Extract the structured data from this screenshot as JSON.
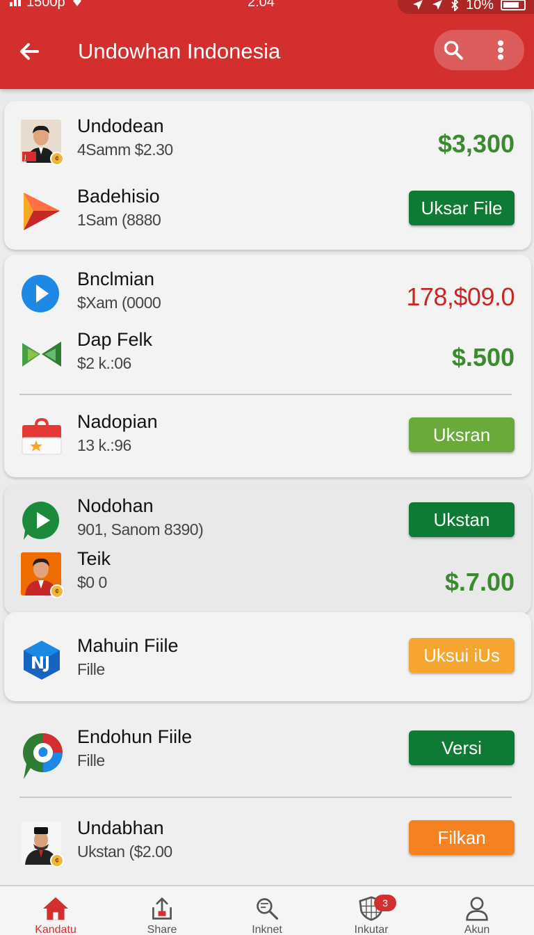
{
  "status_bar": {
    "left": "1500p",
    "time": "2:04",
    "battery": "10%"
  },
  "header": {
    "title": "Undowhan Indonesia"
  },
  "colors": {
    "header_red": "#d32f2f",
    "amount_green": "#3a8a2e",
    "amount_red": "#c62828",
    "button_dark_green": "#0f7a36",
    "button_light_green": "#6aaa3a",
    "button_amber": "#f6a531",
    "button_orange": "#f58220"
  },
  "items": [
    {
      "name": "Undodean",
      "sub": "4Samm $2.30",
      "amount": "$3,300",
      "icon": "avatar-icon"
    },
    {
      "name": "Badehisio",
      "sub": "1Sam (8880",
      "button": "Uksar File",
      "icon": "play-store-triangle-icon"
    },
    {
      "name": "Bnclmian",
      "sub": "$Xam (0000",
      "amount": "178,$09.0",
      "icon": "play-circle-icon"
    },
    {
      "name": "Dap Felk",
      "sub": "$2 k.:06",
      "amount": "$.500",
      "icon": "green-bowtie-icon"
    },
    {
      "name": "Nadopian",
      "sub": "13 k.:96",
      "button": "Uksran",
      "icon": "briefcase-icon"
    },
    {
      "name": "Nodohan",
      "sub": "901, Sanom 8390)",
      "button": "Ukstan",
      "icon": "play-chat-icon"
    },
    {
      "name": "Teik",
      "sub": "$0 0",
      "amount": "$.7.00",
      "icon": "avatar-icon"
    },
    {
      "name": "Mahuin Fiile",
      "sub": "Fille",
      "button": "Uksui iUs",
      "icon": "blue-hex-icon"
    },
    {
      "name": "Endohun Fiile",
      "sub": "Fille",
      "button": "Versi",
      "icon": "colorful-chat-icon"
    },
    {
      "name": "Undabhan",
      "sub": "Ukstan ($2.00",
      "button": "Filkan",
      "icon": "avatar-icon"
    }
  ],
  "bottom_nav": [
    {
      "label": "Kandatu",
      "icon": "home-icon"
    },
    {
      "label": "Share",
      "icon": "upload-icon"
    },
    {
      "label": "Inknet",
      "icon": "search-doc-icon"
    },
    {
      "label": "Inkutar",
      "icon": "shield-grid-icon",
      "badge": "3"
    },
    {
      "label": "Akun",
      "icon": "person-icon"
    }
  ]
}
